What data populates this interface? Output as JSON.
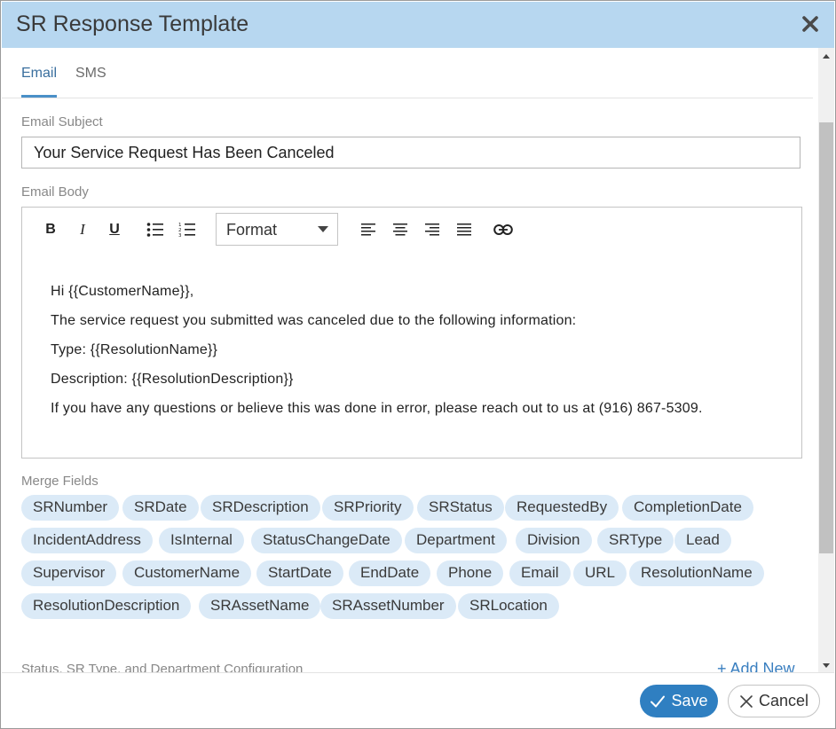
{
  "dialog": {
    "title": "SR Response Template",
    "close_icon": "close-icon"
  },
  "tabs": [
    {
      "label": "Email",
      "active": true
    },
    {
      "label": "SMS",
      "active": false
    }
  ],
  "email_subject": {
    "label": "Email Subject",
    "value": "Your Service Request Has Been Canceled"
  },
  "email_body": {
    "label": "Email Body",
    "toolbar": {
      "bold": "B",
      "italic": "I",
      "underline": "U",
      "format_label": "Format"
    },
    "lines": [
      "Hi  {{CustomerName}},",
      "The service request you submitted was canceled due to the following information:",
      "Type: {{ResolutionName}}",
      "Description: {{ResolutionDescription}}",
      "If you have any questions or believe this was done in error, please reach out to us at (916) 867-5309."
    ]
  },
  "merge_fields": {
    "label": "Merge Fields",
    "items": [
      "SRNumber",
      "SRDate",
      "SRDescription",
      "SRPriority",
      "SRStatus",
      "RequestedBy",
      "CompletionDate",
      "IncidentAddress",
      "IsInternal",
      "StatusChangeDate",
      "Department",
      "Division",
      "SRType",
      "Lead",
      "Supervisor",
      "CustomerName",
      "StartDate",
      "EndDate",
      "Phone",
      "Email",
      "URL",
      "ResolutionName",
      "ResolutionDescription",
      "SRAssetName",
      "SRAssetNumber",
      "SRLocation"
    ]
  },
  "config_section": {
    "label": "Status, SR Type, and Department Configuration",
    "add_new": "+ Add New"
  },
  "footer": {
    "save_label": "Save",
    "cancel_label": "Cancel"
  },
  "colors": {
    "titlebar": "#b7d7f0",
    "accent": "#2f7fc1",
    "chip": "#dbeaf7"
  }
}
